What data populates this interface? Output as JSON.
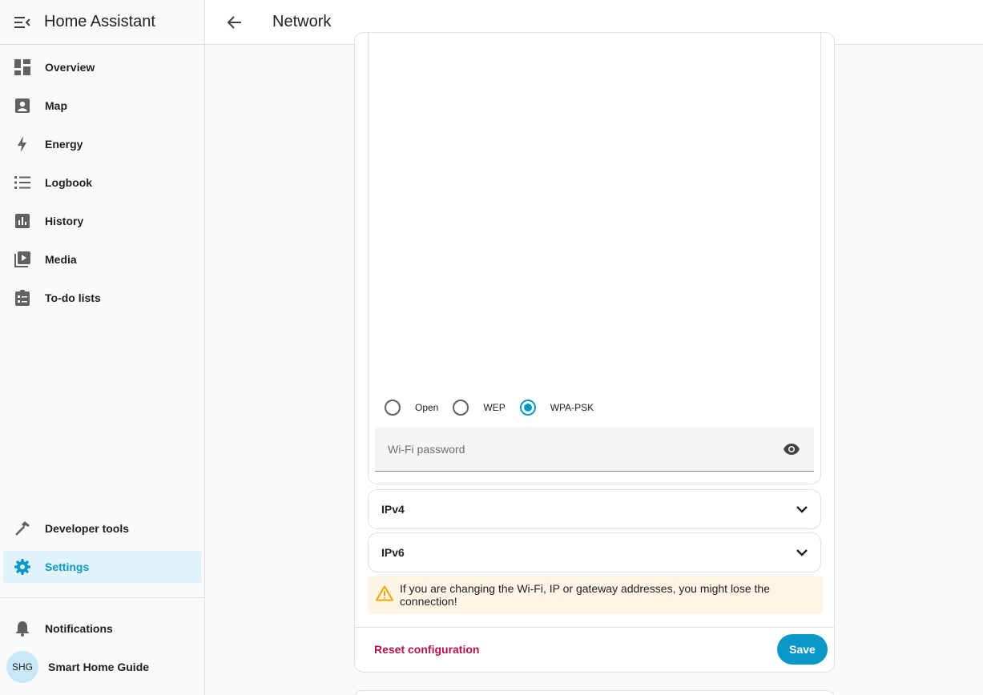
{
  "app": {
    "title": "Home Assistant"
  },
  "topbar": {
    "title": "Network"
  },
  "sidebar": {
    "items": [
      {
        "label": "Overview",
        "icon": "overview-icon"
      },
      {
        "label": "Map",
        "icon": "map-icon"
      },
      {
        "label": "Energy",
        "icon": "energy-icon"
      },
      {
        "label": "Logbook",
        "icon": "logbook-icon"
      },
      {
        "label": "History",
        "icon": "history-icon"
      },
      {
        "label": "Media",
        "icon": "media-icon"
      },
      {
        "label": "To-do lists",
        "icon": "todo-icon"
      }
    ],
    "developer_tools": "Developer tools",
    "settings": "Settings",
    "notifications": "Notifications",
    "user": {
      "initials": "SHG",
      "name": "Smart Home Guide"
    }
  },
  "wifi": {
    "security_options": [
      "Open",
      "WEP",
      "WPA-PSK"
    ],
    "selected_security": "WPA-PSK",
    "password_placeholder": "Wi-Fi password",
    "password_value": ""
  },
  "sections": {
    "ipv4": "IPv4",
    "ipv6": "IPv6"
  },
  "warning": {
    "text": "If you are changing the Wi-Fi, IP or gateway addresses, you might lose the connection!"
  },
  "actions": {
    "reset": "Reset configuration",
    "save": "Save"
  },
  "colors": {
    "accent": "#0b98c7",
    "danger": "#b0124c",
    "warning_bg": "#fff4e6",
    "active_bg": "#e1f3fa"
  }
}
